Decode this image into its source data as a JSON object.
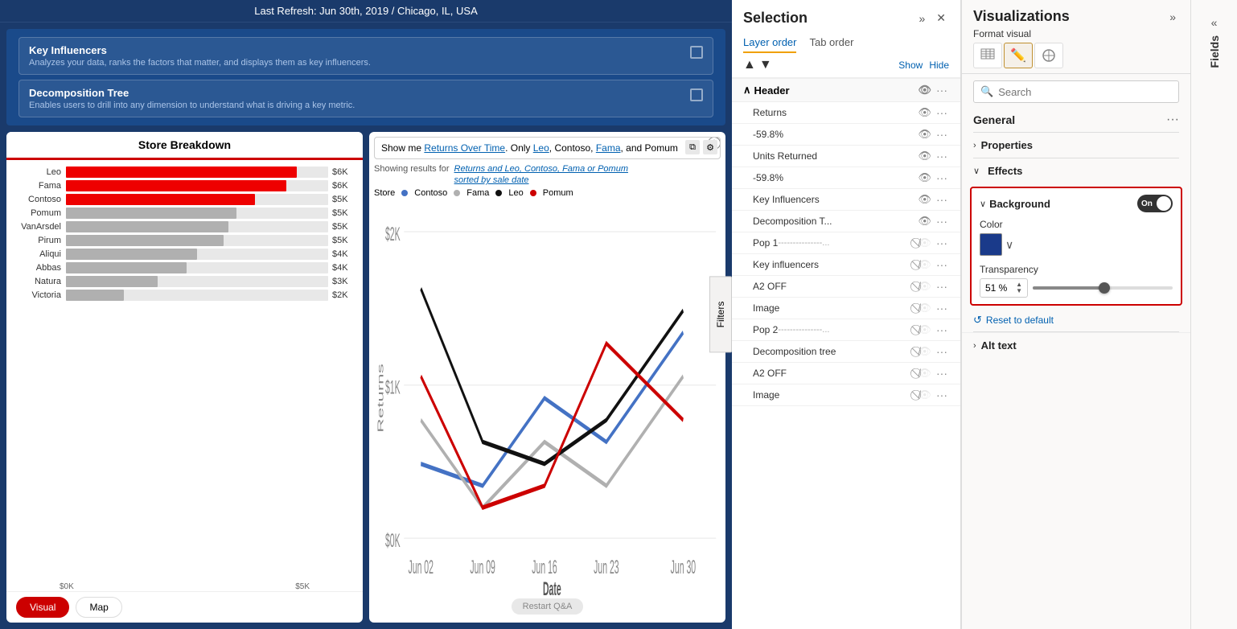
{
  "topbar": {
    "refresh_text": "Last Refresh: Jun 30th, 2019 / Chicago, IL, USA"
  },
  "viz_options": [
    {
      "title": "Key Influencers",
      "description": "Analyzes your data, ranks the factors that matter, and displays them as key influencers."
    },
    {
      "title": "Decomposition Tree",
      "description": "Enables users to drill into any dimension to understand what is driving a key metric."
    }
  ],
  "bar_chart": {
    "title": "Store Breakdown",
    "bars": [
      {
        "label": "Leo",
        "value": "$6K",
        "pct": 88,
        "red": true
      },
      {
        "label": "Fama",
        "value": "$6K",
        "pct": 84,
        "red": true
      },
      {
        "label": "Contoso",
        "value": "$5K",
        "pct": 72,
        "red": true
      },
      {
        "label": "Pomum",
        "value": "$5K",
        "pct": 65,
        "red": false
      },
      {
        "label": "VanArsdel",
        "value": "$5K",
        "pct": 62,
        "red": false
      },
      {
        "label": "Pirum",
        "value": "$5K",
        "pct": 60,
        "red": false
      },
      {
        "label": "Aliqui",
        "value": "$4K",
        "pct": 50,
        "red": false
      },
      {
        "label": "Abbas",
        "value": "$4K",
        "pct": 46,
        "red": false
      },
      {
        "label": "Natura",
        "value": "$3K",
        "pct": 35,
        "red": false
      },
      {
        "label": "Victoria",
        "value": "$2K",
        "pct": 22,
        "red": false
      }
    ],
    "x_axis": [
      "$0K",
      "$5K"
    ],
    "tabs": [
      "Visual",
      "Map"
    ]
  },
  "qa_chart": {
    "query_text": "Show me Returns Over Time. Only Leo, Contoso, Fama, and Pomum",
    "showing_label": "Showing results for",
    "showing_link": "Returns and Leo, Contoso, Fama or Pomum",
    "sorted_label": "sorted by sale date",
    "legend": [
      {
        "name": "Contoso",
        "color": "#4472C4"
      },
      {
        "name": "Fama",
        "color": "#b0b0b0"
      },
      {
        "name": "Leo",
        "color": "#111111"
      },
      {
        "name": "Pomum",
        "color": "#c00"
      }
    ],
    "x_labels": [
      "Jun 02",
      "Jun 09",
      "Jun 16",
      "Jun 23",
      "Jun 30"
    ],
    "y_labels": [
      "$2K",
      "$1K",
      "$0K"
    ],
    "x_axis_label": "Date",
    "y_axis_label": "Returns",
    "restart_btn": "Restart Q&A"
  },
  "selection": {
    "title": "Selection",
    "tab_layer": "Layer order",
    "tab_order": "Tab order",
    "show": "Show",
    "hide": "Hide",
    "header": "Header",
    "items": [
      {
        "label": "Returns",
        "visible": true,
        "dashed": false
      },
      {
        "label": "-59.8%",
        "visible": true,
        "dashed": false
      },
      {
        "label": "Units Returned",
        "visible": true,
        "dashed": false
      },
      {
        "label": "-59.8%",
        "visible": true,
        "dashed": false
      },
      {
        "label": "Key Influencers",
        "visible": true,
        "dashed": false
      },
      {
        "label": "Decomposition T...",
        "visible": true,
        "dashed": false
      },
      {
        "label": "Pop 1",
        "visible": false,
        "dashed": true
      },
      {
        "label": "Key influencers",
        "visible": false,
        "dashed": false
      },
      {
        "label": "A2 OFF",
        "visible": false,
        "dashed": false
      },
      {
        "label": "Image",
        "visible": false,
        "dashed": false
      },
      {
        "label": "Pop 2",
        "visible": false,
        "dashed": true
      },
      {
        "label": "Decomposition tree",
        "visible": false,
        "dashed": false
      },
      {
        "label": "A2 OFF",
        "visible": false,
        "dashed": false
      },
      {
        "label": "Image",
        "visible": false,
        "dashed": false
      }
    ]
  },
  "visualizations": {
    "title": "Visualizations",
    "expand_icon": "»",
    "format_visual": "Format visual",
    "search_placeholder": "Search",
    "general_label": "General",
    "properties_label": "Properties",
    "effects_label": "Effects",
    "background_label": "Background",
    "toggle_text": "On",
    "color_label": "Color",
    "transparency_label": "Transparency",
    "transparency_value": "51 %",
    "reset_label": "Reset to default",
    "alt_text_label": "Alt text"
  },
  "fields": {
    "label": "Fields"
  }
}
